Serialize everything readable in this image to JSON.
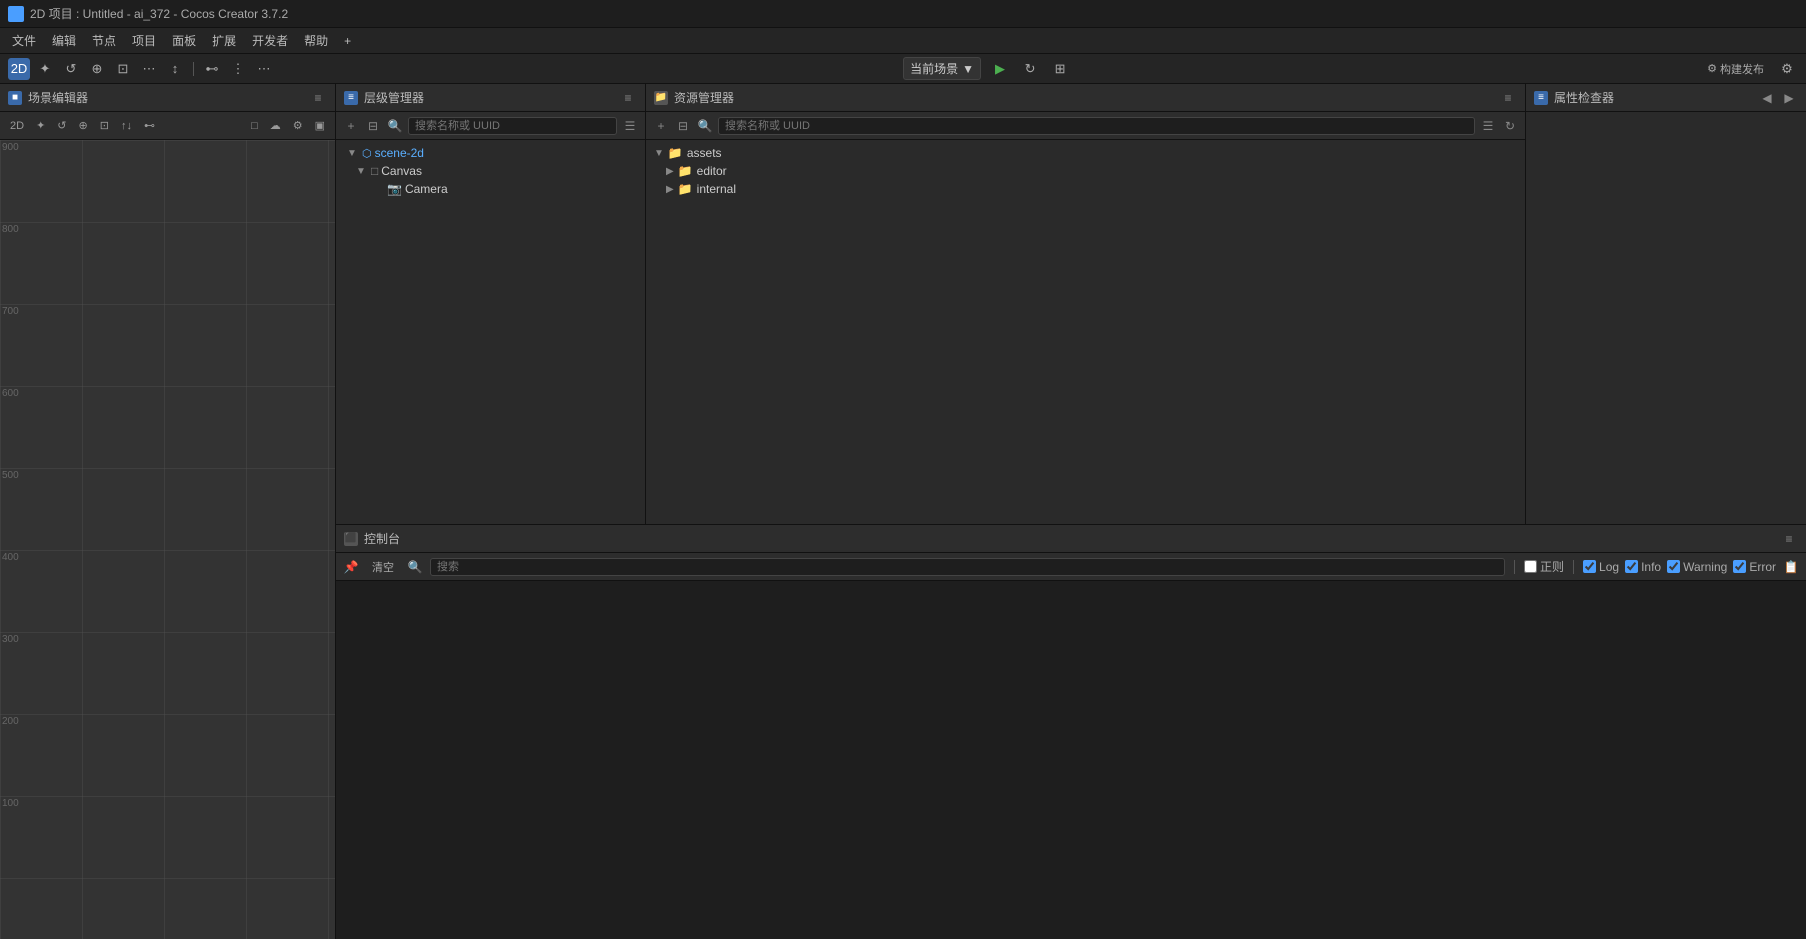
{
  "titleBar": {
    "icon": "2D",
    "title": "2D 项目 : Untitled - ai_372 - Cocos Creator 3.7.2"
  },
  "menuBar": {
    "items": [
      "文件",
      "编辑",
      "节点",
      "项目",
      "面板",
      "扩展",
      "开发者",
      "帮助",
      "+"
    ]
  },
  "toolbar": {
    "mode": "2D",
    "tools": [
      "move",
      "rotate",
      "scale",
      "rect",
      "transform",
      "anchor",
      "divider",
      "gizmo1",
      "gizmo2",
      "gizmo3",
      "gizmo4"
    ],
    "sceneLabel": "当前场景",
    "playBtn": "▶",
    "refreshBtn": "↻",
    "layoutBtn": "⊞",
    "buildBtn": "构建发布",
    "settingsBtn": "⚙"
  },
  "sceneEditor": {
    "panelTitle": "场景编辑器",
    "toolbar": {
      "modeBtn": "2D",
      "tools": [
        "✦",
        "↺",
        "⊕",
        "⊡",
        "⋯",
        "↕",
        "⊷"
      ],
      "rightTools": [
        "□",
        "☁",
        "⚙",
        "▣"
      ]
    },
    "gridLabels": [
      "900",
      "800",
      "700",
      "600",
      "500",
      "400",
      "300",
      "200",
      "100"
    ]
  },
  "hierarchy": {
    "panelTitle": "层级管理器",
    "searchPlaceholder": "搜索名称或 UUID",
    "tree": [
      {
        "id": "scene-2d",
        "label": "scene-2d",
        "level": 0,
        "expanded": true,
        "type": "scene"
      },
      {
        "id": "canvas",
        "label": "Canvas",
        "level": 1,
        "expanded": true,
        "type": "node"
      },
      {
        "id": "camera",
        "label": "Camera",
        "level": 2,
        "expanded": false,
        "type": "node"
      }
    ]
  },
  "assets": {
    "panelTitle": "资源管理器",
    "searchPlaceholder": "搜索名称或 UUID",
    "tree": [
      {
        "id": "assets",
        "label": "assets",
        "level": 0,
        "expanded": true,
        "type": "folder"
      },
      {
        "id": "editor",
        "label": "editor",
        "level": 1,
        "expanded": false,
        "type": "folder"
      },
      {
        "id": "internal",
        "label": "internal",
        "level": 1,
        "expanded": false,
        "type": "folder"
      }
    ]
  },
  "inspector": {
    "panelTitle": "属性检查器"
  },
  "console": {
    "panelTitle": "控制台",
    "clearBtn": "清空",
    "searchPlaceholder": "搜索",
    "normalLabel": "正则",
    "filters": [
      {
        "id": "log",
        "label": "Log",
        "checked": true
      },
      {
        "id": "info",
        "label": "Info",
        "checked": true
      },
      {
        "id": "warning",
        "label": "Warning",
        "checked": true
      },
      {
        "id": "error",
        "label": "Error",
        "checked": true
      }
    ]
  }
}
